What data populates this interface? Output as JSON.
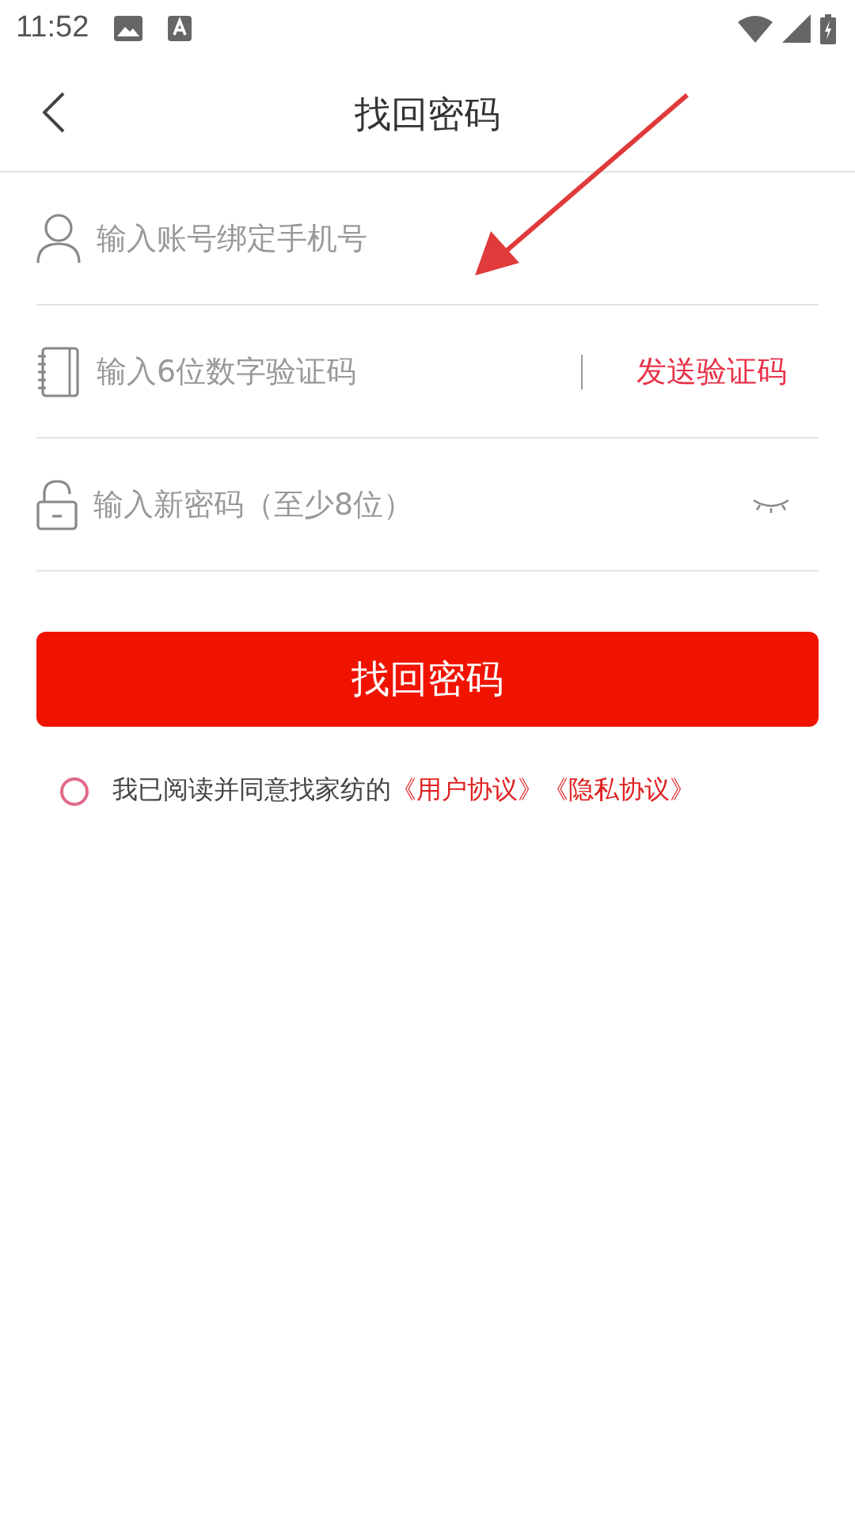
{
  "status_bar": {
    "time": "11:52"
  },
  "header": {
    "title": "找回密码"
  },
  "fields": [
    {
      "kind": "account",
      "placeholder": "输入账号绑定手机号"
    },
    {
      "kind": "code",
      "placeholder": "输入6位数字验证码",
      "action": "发送验证码"
    },
    {
      "kind": "password",
      "placeholder": "输入新密码（至少8位）",
      "password_visible": false
    }
  ],
  "submit": "找回密码",
  "agreement": {
    "checked": false,
    "text": "我已阅读并同意找家纺的",
    "links": [
      "《用户协议》",
      "《隐私协议》"
    ]
  },
  "annotation": {
    "kind": "arrow"
  }
}
